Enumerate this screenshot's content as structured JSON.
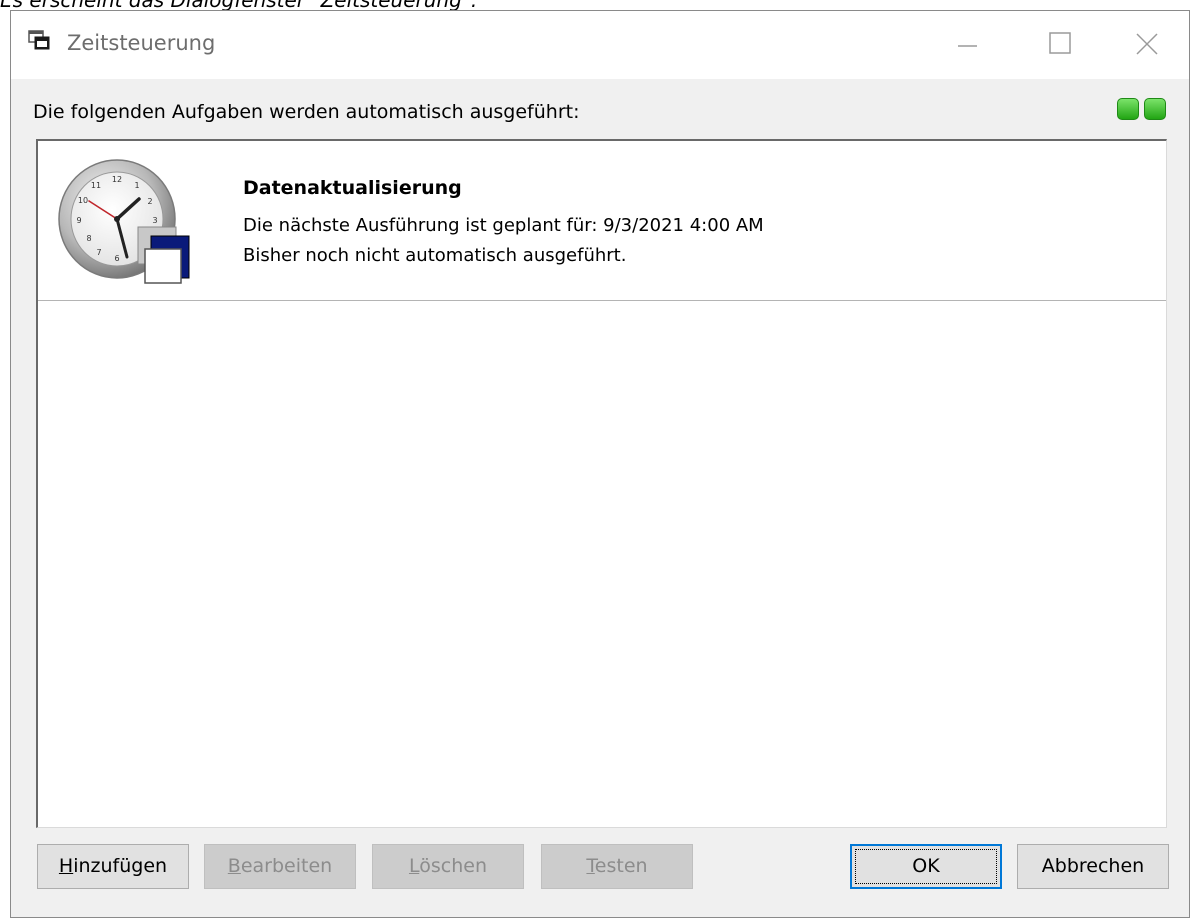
{
  "page_caption": "Es erscheint das Dialogfenster \"Zeitsteuerung\":",
  "window": {
    "title": "Zeitsteuerung",
    "icon": "window-restore-icon",
    "controls": {
      "minimize": "minimize-icon",
      "maximize": "maximize-icon",
      "close": "close-icon"
    }
  },
  "intro_text": "Die folgenden Aufgaben werden automatisch ausgeführt:",
  "status_indicators": {
    "count": 2,
    "color": "#22a514"
  },
  "tasks": [
    {
      "icon": "clock-icon",
      "title": "Datenaktualisierung",
      "next_run": "Die nächste Ausführung ist geplant für: 9/3/2021 4:00 AM",
      "last_run": "Bisher noch nicht automatisch ausgeführt."
    }
  ],
  "buttons": {
    "add": {
      "mnemonic": "H",
      "rest": "inzufügen",
      "enabled": true
    },
    "edit": {
      "mnemonic": "B",
      "rest": "earbeiten",
      "enabled": false
    },
    "delete": {
      "mnemonic": "L",
      "rest": "öschen",
      "enabled": false
    },
    "test": {
      "mnemonic": "T",
      "rest": "esten",
      "enabled": false
    },
    "ok": {
      "label": "OK",
      "enabled": true
    },
    "cancel": {
      "label": "Abbrechen",
      "enabled": true
    }
  },
  "colors": {
    "accent": "#0078d7",
    "dialog_bg": "#f0f0f0",
    "disabled_text": "#8c8c8c"
  }
}
